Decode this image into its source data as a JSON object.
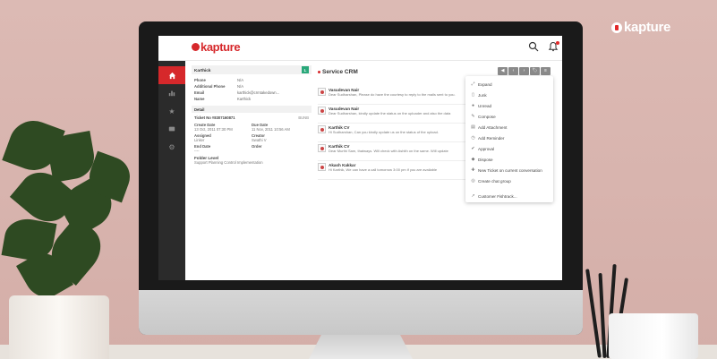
{
  "brand": {
    "name": "kapture"
  },
  "app": {
    "logo": "kapture",
    "topbar_icons": [
      "search-icon",
      "bell-icon"
    ],
    "accent_color": "#d6282b"
  },
  "rail": {
    "items": [
      "home-icon",
      "chart-icon",
      "star-icon",
      "chat-icon",
      "settings-icon"
    ]
  },
  "customer": {
    "name": "Karthick",
    "badge": "L",
    "fields": [
      {
        "label": "Phone",
        "value": "N/A"
      },
      {
        "label": "Additional Phone",
        "value": "N/A"
      },
      {
        "label": "Email",
        "value": "karthick@crmtakedown..."
      },
      {
        "label": "Name",
        "value": "Karthick"
      }
    ],
    "detail_title": "Detail",
    "ticket_no": "Ticket No #8307160871",
    "ticket_status": "BUNB",
    "details": [
      {
        "label": "Create Date",
        "value": "13 Oct, 2011 07:30 PM"
      },
      {
        "label": "Due Date",
        "value": "11 Nov, 2011 10:56 AM"
      },
      {
        "label": "Assigned",
        "value": "Linker"
      },
      {
        "label": "Creator",
        "value": "Swathi V"
      },
      {
        "label": "End Date",
        "value": "----"
      },
      {
        "label": "Order",
        "value": ""
      }
    ],
    "folder_label": "Folder Level",
    "folder_value": "Support Planning Control Implementation"
  },
  "service": {
    "title": "Service CRM",
    "toolbar": [
      "◀",
      "‹",
      "›",
      "🏷",
      "≡"
    ],
    "conversations": [
      {
        "name": "Vasudevan Nair",
        "preview": "Dear Sudharshan, Please do have the courtesy to reply to the mails sent to you."
      },
      {
        "name": "Vasudevan Nair",
        "preview": "Dear Sudharshan, kindly update the status on the uploader and also the data"
      },
      {
        "name": "Karthik CV",
        "preview": "Hi Sudharshan, Can you kindly update us on the status of the upload."
      },
      {
        "name": "Karthik CV",
        "preview": "Dear Murthi Sam, thatways. Will check with Ashith on the same. Will update"
      },
      {
        "name": "Akash Kakkar",
        "preview": "Hi Karthik, We can have a call tomorrow 3:00 pm if you are available"
      }
    ]
  },
  "menu": {
    "items": [
      {
        "icon": "expand-icon",
        "label": "Expand"
      },
      {
        "icon": "lock-icon",
        "label": "Junk"
      },
      {
        "icon": "circle-icon",
        "label": "Unread"
      },
      {
        "icon": "pencil-icon",
        "label": "Compose"
      },
      {
        "icon": "attachment-icon",
        "label": "Add Attachment"
      },
      {
        "icon": "reminder-icon",
        "label": "Add Reminder"
      },
      {
        "icon": "approve-icon",
        "label": "Approval"
      },
      {
        "icon": "tag-icon",
        "label": "Dispose"
      },
      {
        "icon": "ticket-icon",
        "label": "New Ticket on current conversation"
      },
      {
        "icon": "group-icon",
        "label": "Create chat group"
      },
      {
        "icon": "external-icon",
        "label": "Customer Fishtrack..."
      }
    ]
  }
}
